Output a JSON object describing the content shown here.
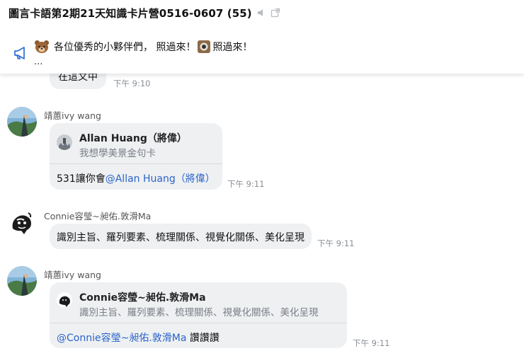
{
  "header": {
    "title": "圖言卡語第2期21天知識卡片營0516-0607 (55)",
    "mute_icon": "speaker-muted-icon",
    "popout_icon": "popout-icon"
  },
  "announcement": {
    "icon": "megaphone-icon",
    "text_1": "各位優秀的小夥伴們，  照過來！",
    "text_2": "照過來！",
    "more": "..."
  },
  "messages": [
    {
      "text": "在這文中",
      "time": "下午 9:10"
    },
    {
      "sender": "靖蕙ivy wang",
      "quote_name": "Allan Huang（將偉）",
      "quote_text": "我想學美景金句卡",
      "reply_prefix": "531讓你會",
      "reply_mention": "@Allan Huang（將偉）",
      "time": "下午 9:11"
    },
    {
      "sender": "Connie容瑩~昶佑.敦滑Ma",
      "text": "識別主旨、羅列要素、梳理關係、視覺化關係、美化呈現",
      "time": "下午 9:11"
    },
    {
      "sender": "靖蕙ivy wang",
      "quote_name": "Connie容瑩~昶佑.敦滑Ma",
      "quote_text": "識別主旨、羅列要素、梳理關係、視覺化關係、美化呈現",
      "reply_mention": "@Connie容瑩~昶佑.敦滑Ma",
      "reply_suffix": " 讚讚讚",
      "time": "下午 9:11"
    }
  ]
}
